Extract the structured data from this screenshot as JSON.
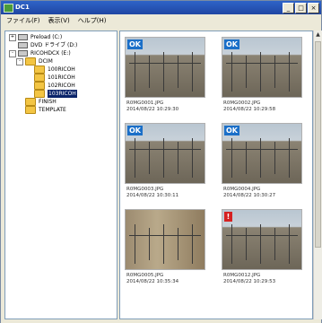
{
  "window": {
    "title": "DC1"
  },
  "window_buttons": [
    "_",
    "□",
    "×"
  ],
  "menu": [
    "ファイル(F)",
    "表示(V)",
    "ヘルプ(H)"
  ],
  "tree": [
    {
      "label": "Preload (C:)",
      "icon": "drive-icon",
      "toggle": "+"
    },
    {
      "label": "DVD ドライブ (D:)",
      "icon": "dvd-drive-icon",
      "toggle": ""
    },
    {
      "label": "RICOHDCX (E:)",
      "icon": "drive-icon",
      "toggle": "-"
    },
    {
      "label": "DCIM",
      "icon": "folder-icon",
      "toggle": "-"
    },
    {
      "label": "100RICOH",
      "icon": "folder-icon",
      "toggle": ""
    },
    {
      "label": "101RICOH",
      "icon": "folder-icon",
      "toggle": ""
    },
    {
      "label": "102RICOH",
      "icon": "folder-icon",
      "toggle": ""
    },
    {
      "label": "103RICOH",
      "icon": "folder-open-icon",
      "toggle": "",
      "selected": true
    },
    {
      "label": "FINISH",
      "icon": "folder-icon",
      "toggle": ""
    },
    {
      "label": "TEMPLATE",
      "icon": "folder-icon",
      "toggle": ""
    }
  ],
  "thumbnails": [
    {
      "name": "R0MG0001.JPG",
      "date": "2014/08/22 10:29:30",
      "badge": "OK",
      "badge_type": "ok"
    },
    {
      "name": "R0MG0002.JPG",
      "date": "2014/08/22 10:29:58",
      "badge": "OK",
      "badge_type": "ok"
    },
    {
      "name": "R0MG0003.JPG",
      "date": "2014/08/22 10:30:11",
      "badge": "OK",
      "badge_type": "ok"
    },
    {
      "name": "R0MG0004.JPG",
      "date": "2014/08/22 10:30:27",
      "badge": "OK",
      "badge_type": "ok"
    },
    {
      "name": "R0MG0005.JPG",
      "date": "2014/08/22 10:35:34",
      "badge": "",
      "badge_type": "none"
    },
    {
      "name": "R0MG0012.JPG",
      "date": "2014/08/22 10:29:53",
      "badge": "!",
      "badge_type": "warn"
    }
  ]
}
